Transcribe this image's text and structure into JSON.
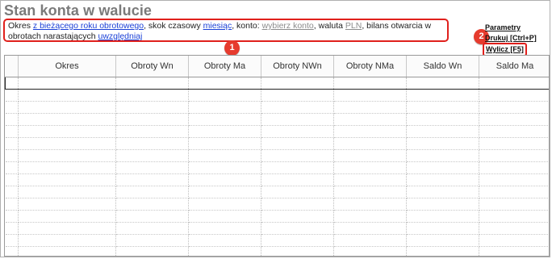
{
  "page": {
    "title": "Stan konta w walucie"
  },
  "description": {
    "t1": "Okres ",
    "period_link": "z bieżącego roku obrotowego",
    "t2": ", skok czasowy ",
    "step_link": "miesiąc",
    "t3": ", konto: ",
    "account_link": "wybierz konto",
    "t4": ", waluta ",
    "currency_link": "PLN",
    "t5": ", bilans otwarcia w obrotach narastających ",
    "opening_link": "uwzględniaj"
  },
  "actions": {
    "parametry": "Parametry",
    "drukuj": "Drukuj [Ctrl+P]",
    "wylicz": "Wylicz [F5]"
  },
  "badges": {
    "b1": "1",
    "b2": "2"
  },
  "table": {
    "columns": [
      "Okres",
      "Obroty Wn",
      "Obroty Ma",
      "Obroty NWn",
      "Obroty NMa",
      "Saldo Wn",
      "Saldo Ma"
    ],
    "rows": []
  },
  "colors": {
    "highlight": "#e0201c",
    "badge": "#e63b2e",
    "link": "#1a3fd6",
    "title": "#7a7a7a"
  }
}
